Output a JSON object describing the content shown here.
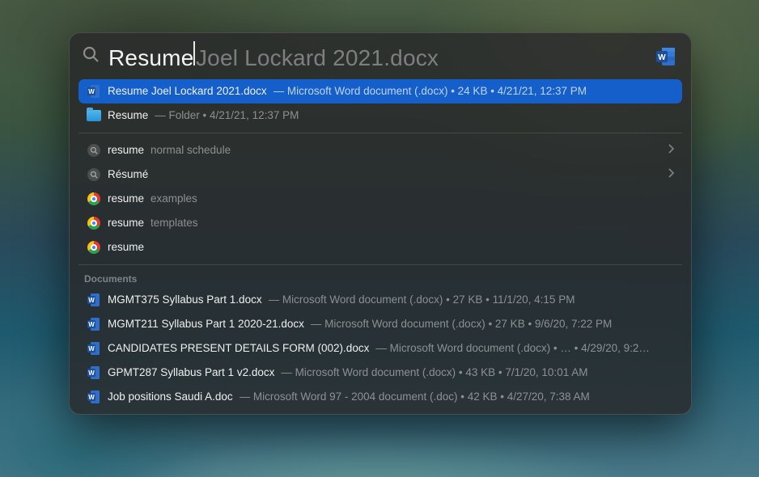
{
  "search": {
    "typed": "Resume",
    "completion": " Joel Lockard 2021.docx"
  },
  "topHits": [
    {
      "icon": "word",
      "title": "Resume Joel Lockard 2021.docx",
      "meta": " — Microsoft Word document (.docx) • 24 KB • 4/21/21, 12:37 PM",
      "selected": true
    },
    {
      "icon": "folder",
      "title": "Resume",
      "meta": " — Folder • 4/21/21, 12:37 PM",
      "selected": false
    }
  ],
  "suggestions": [
    {
      "icon": "safari",
      "match": "resume",
      "rest": " normal schedule",
      "chevron": true
    },
    {
      "icon": "safari",
      "match": "Résumé",
      "rest": "",
      "chevron": true
    },
    {
      "icon": "chrome",
      "match": "resume",
      "rest": " examples",
      "chevron": false
    },
    {
      "icon": "chrome",
      "match": "resume",
      "rest": " templates",
      "chevron": false
    },
    {
      "icon": "chrome",
      "match": "resume",
      "rest": "",
      "chevron": false
    }
  ],
  "documentsSection": {
    "label": "Documents",
    "items": [
      {
        "icon": "word",
        "title": "MGMT375 Syllabus Part 1.docx",
        "meta": " — Microsoft Word document (.docx) • 27 KB • 11/1/20, 4:15 PM"
      },
      {
        "icon": "word",
        "title": "MGMT211 Syllabus Part 1 2020-21.docx",
        "meta": " — Microsoft Word document (.docx) • 27 KB • 9/6/20, 7:22 PM"
      },
      {
        "icon": "word",
        "title": "CANDIDATES PRESENT DETAILS FORM (002).docx",
        "meta": " — Microsoft Word document (.docx) • … • 4/29/20, 9:2…"
      },
      {
        "icon": "word",
        "title": "GPMT287 Syllabus Part 1 v2.docx",
        "meta": " — Microsoft Word document (.docx) • 43 KB • 7/1/20, 10:01 AM"
      },
      {
        "icon": "word",
        "title": "Job positions Saudi  A.doc",
        "meta": " — Microsoft Word 97 - 2004 document (.doc) • 42 KB • 4/27/20, 7:38 AM"
      }
    ]
  }
}
